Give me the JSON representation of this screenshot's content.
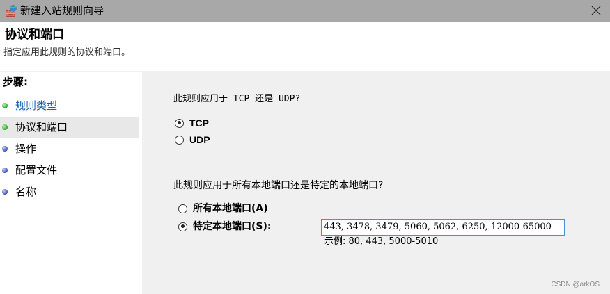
{
  "window": {
    "title": "新建入站规则向导"
  },
  "header": {
    "title": "协议和端口",
    "description": "指定应用此规则的协议和端口。"
  },
  "sidebar": {
    "steps_label": "步骤:",
    "items": [
      {
        "label": "规则类型",
        "state": "done",
        "dot": "green"
      },
      {
        "label": "协议和端口",
        "state": "current",
        "dot": "green"
      },
      {
        "label": "操作",
        "state": "pending",
        "dot": "blue"
      },
      {
        "label": "配置文件",
        "state": "pending",
        "dot": "blue"
      },
      {
        "label": "名称",
        "state": "pending",
        "dot": "blue"
      }
    ]
  },
  "main": {
    "protocol_question": "此规则应用于 TCP 还是 UDP?",
    "protocol_options": [
      {
        "label": "TCP",
        "checked": true
      },
      {
        "label": "UDP",
        "checked": false
      }
    ],
    "port_question": "此规则应用于所有本地端口还是特定的本地端口?",
    "port_options": [
      {
        "label": "所有本地端口(A)",
        "checked": false
      },
      {
        "label": "特定本地端口(S):",
        "checked": true
      }
    ],
    "port_value": "443, 3478, 3479, 5060, 5062, 6250, 12000-65000",
    "example_text": "示例: 80, 443, 5000-5010"
  },
  "watermark": "CSDN @arkOS",
  "colors": {
    "titlebar": "#a8a8a8",
    "content_bg": "#f0f0f0",
    "link": "#1a5fb4",
    "input_border": "#4a90d9"
  }
}
